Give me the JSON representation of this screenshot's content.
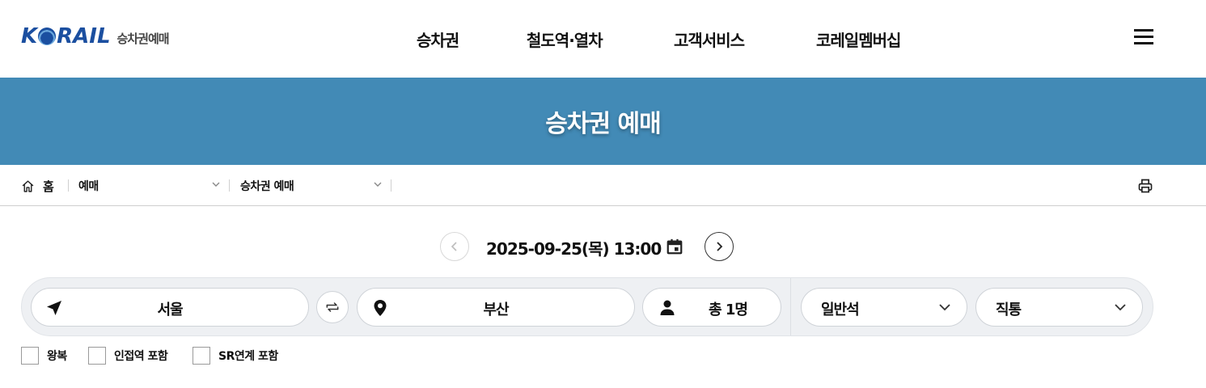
{
  "header": {
    "logo_text_1": "K",
    "logo_text_2": "RAIL",
    "logo_subtitle": "승차권예매",
    "nav": [
      {
        "label": "승차권"
      },
      {
        "label": "철도역·열차"
      },
      {
        "label": "고객서비스"
      },
      {
        "label": "코레일멤버십"
      }
    ],
    "menu_icon": "hamburger-icon"
  },
  "banner": {
    "title": "승차권 예매",
    "background_color": "#428ab6"
  },
  "breadcrumb": {
    "home_label": "홈",
    "level1": "예매",
    "level2": "승차권 예매",
    "print_icon": "print-icon"
  },
  "date_selector": {
    "date_text": "2025-09-25(목) 13:00",
    "prev_icon": "chevron-left-icon",
    "next_icon": "chevron-right-icon",
    "calendar_icon": "calendar-icon"
  },
  "search": {
    "departure": "서울",
    "arrival": "부산",
    "passengers": "총 1명",
    "seat_class": "일반석",
    "train_type": "직통",
    "departure_icon": "navigation-arrow-icon",
    "arrival_icon": "location-pin-icon",
    "passenger_icon": "person-icon",
    "swap_icon": "swap-arrows-icon"
  },
  "options": [
    {
      "label": "왕복",
      "checked": false
    },
    {
      "label": "인접역 포함",
      "checked": false
    },
    {
      "label": "SR연계 포함",
      "checked": false
    }
  ]
}
